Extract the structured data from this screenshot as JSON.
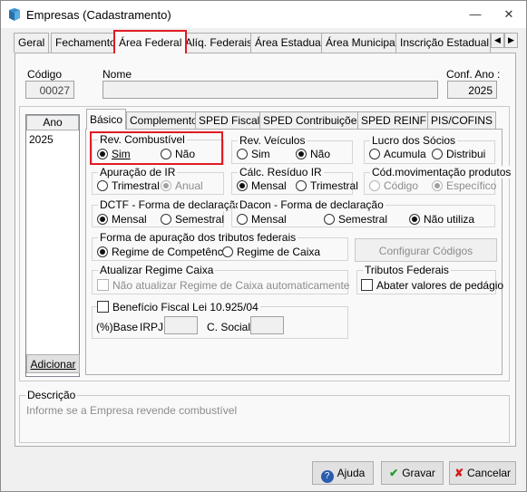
{
  "window": {
    "title": "Empresas (Cadastramento)"
  },
  "main_tabs": [
    {
      "label": "Geral"
    },
    {
      "label": "Fechamento"
    },
    {
      "label": "Área Federal"
    },
    {
      "label": "Alíq. Federais"
    },
    {
      "label": "Área Estadual"
    },
    {
      "label": "Área Municipal"
    },
    {
      "label": "Inscrição Estadual S"
    }
  ],
  "header": {
    "codigo_label": "Código",
    "codigo_value": "00027",
    "nome_label": "Nome",
    "nome_value": "",
    "conf_ano_label": "Conf. Ano :",
    "conf_ano_value": "2025"
  },
  "year_list": {
    "header": "Ano",
    "items": [
      "2025"
    ],
    "add_button": "Adicionar"
  },
  "sub_tabs": [
    {
      "label": "Básico"
    },
    {
      "label": "Complemento"
    },
    {
      "label": "SPED Fiscal"
    },
    {
      "label": "SPED Contribuições"
    },
    {
      "label": "SPED REINF"
    },
    {
      "label": "PIS/COFINS"
    }
  ],
  "groups": {
    "rev_combustivel": {
      "title": "Rev. Combustível",
      "opt1": "Sim",
      "opt2": "Não",
      "selected": "Sim"
    },
    "rev_veiculos": {
      "title": "Rev. Veículos",
      "opt1": "Sim",
      "opt2": "Não",
      "selected": "Não"
    },
    "lucro_socios": {
      "title": "Lucro dos Sócios",
      "opt1": "Acumula",
      "opt2": "Distribui"
    },
    "apuracao_ir": {
      "title": "Apuração de IR",
      "opt1": "Trimestral",
      "opt2": "Anual",
      "selected": "Anual"
    },
    "calc_residuo_ir": {
      "title": "Cálc. Resíduo IR",
      "opt1": "Mensal",
      "opt2": "Trimestral",
      "selected": "Mensal"
    },
    "cod_mov_produtos": {
      "title": "Cód.movimentação produtos",
      "opt1": "Código",
      "opt2": "Específico",
      "selected": "Específico"
    },
    "dctf": {
      "title": "DCTF - Forma de declaração",
      "opt1": "Mensal",
      "opt2": "Semestral",
      "selected": "Mensal"
    },
    "dacon": {
      "title": "Dacon - Forma de declaração",
      "opt1": "Mensal",
      "opt2": "Semestral",
      "opt3": "Não utiliza",
      "selected": "Não utiliza"
    },
    "forma_apuracao": {
      "title": "Forma de apuração dos tributos federais",
      "opt1": "Regime de Competência",
      "opt2": "Regime de Caixa",
      "selected": "Regime de Competência"
    },
    "configurar_codigos": "Configurar Códigos",
    "atualizar_regime": {
      "title": "Atualizar Regime Caixa",
      "checkbox": "Não atualizar Regime de Caixa automaticamente"
    },
    "tributos_federais": {
      "title": "Tributos Federais",
      "checkbox": "Abater valores de pedágio"
    },
    "beneficio_fiscal": {
      "checkbox": "Benefício Fiscal Lei 10.925/04",
      "base_label": "(%)Base",
      "irpj_label": "IRPJ",
      "csocial_label": "C. Social"
    }
  },
  "descricao": {
    "title": "Descrição",
    "text": "Informe se a Empresa revende combustível"
  },
  "buttons": {
    "ajuda": "Ajuda",
    "gravar": "Gravar",
    "cancelar": "Cancelar"
  },
  "colors": {
    "highlight": "#e01b24",
    "check_green": "#1f9d2a",
    "cancel_red": "#d41a1a",
    "help_blue": "#2a5db0"
  }
}
